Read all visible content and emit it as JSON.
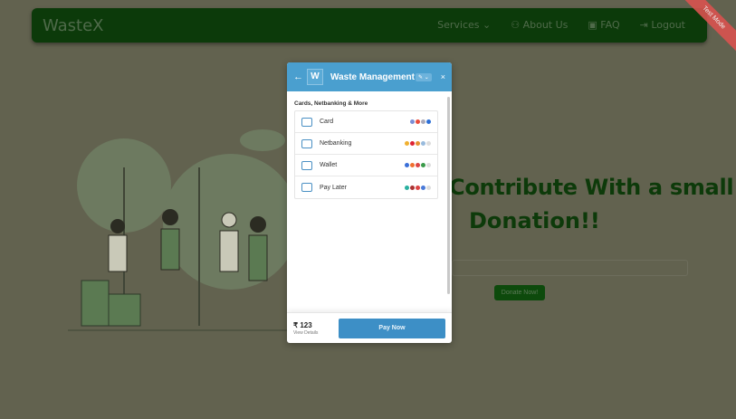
{
  "navbar": {
    "brand": "WasteX",
    "items": [
      {
        "label": "Services ⌄",
        "icon": "chevron-down-icon"
      },
      {
        "label": "About Us",
        "icon": "users-icon"
      },
      {
        "label": "FAQ",
        "icon": "clipboard-icon"
      },
      {
        "label": "Logout",
        "icon": "logout-icon"
      }
    ]
  },
  "ribbon": "Test Mode",
  "hero": {
    "title_line1": "Contribute With a small",
    "title_line2": "Donation!!",
    "donate_button": "Donate Now!"
  },
  "modal": {
    "title": "Waste Management",
    "logo_letter": "W",
    "back": "←",
    "close": "×",
    "lang": "✎ ⌄",
    "section_title": "Cards, Netbanking & More",
    "methods": [
      {
        "label": "Card",
        "icon": "card-icon"
      },
      {
        "label": "Netbanking",
        "icon": "bank-icon"
      },
      {
        "label": "Wallet",
        "icon": "wallet-icon"
      },
      {
        "label": "Pay Later",
        "icon": "paylater-icon"
      }
    ],
    "amount": "₹ 123",
    "view_details": "View Details",
    "pay_button": "Pay Now"
  },
  "colors": {
    "navbar": "#0c3a0a",
    "modal_header": "#4a9fcf",
    "pay_button": "#3d8fc6"
  }
}
